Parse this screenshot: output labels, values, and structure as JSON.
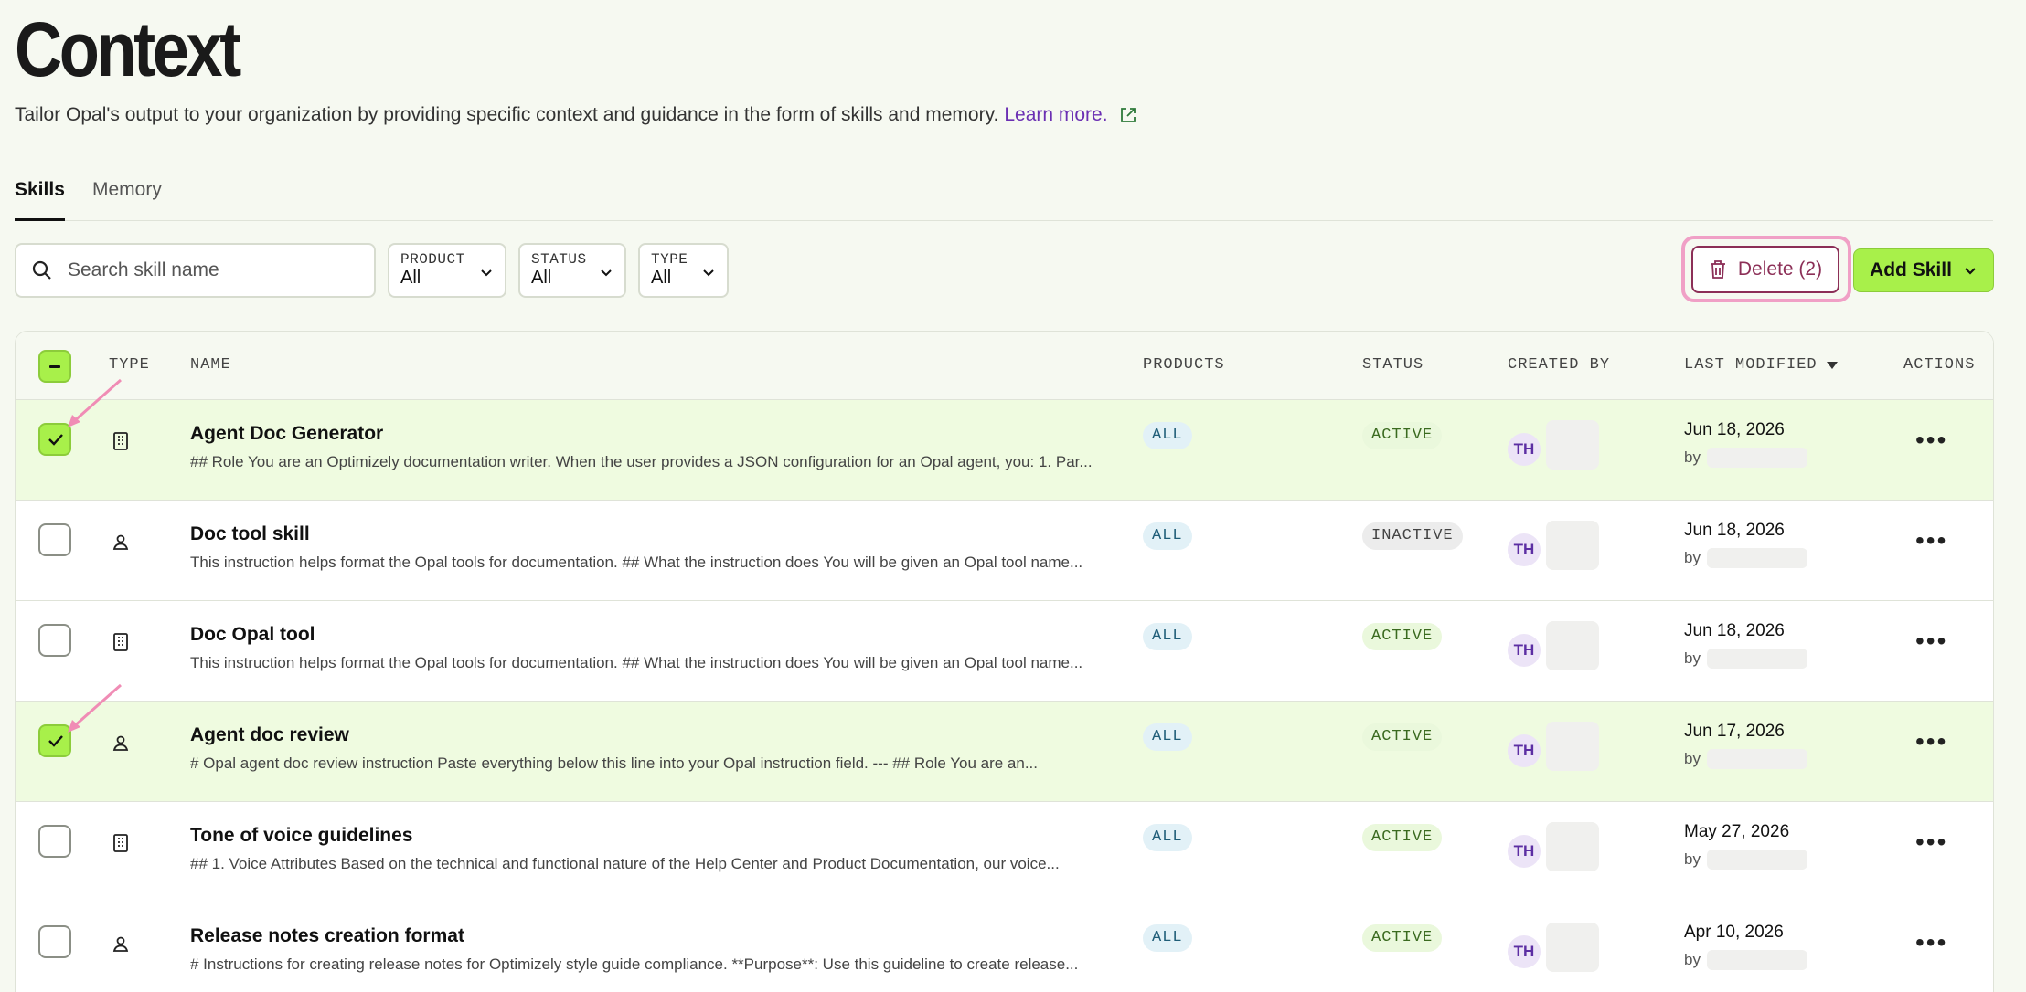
{
  "page": {
    "title": "Context",
    "subtitle": "Tailor Opal's output to your organization by providing specific context and guidance in the form of skills and memory.",
    "learn_more": "Learn more."
  },
  "tabs": [
    {
      "label": "Skills",
      "active": true
    },
    {
      "label": "Memory",
      "active": false
    }
  ],
  "search": {
    "placeholder": "Search skill name",
    "icon": "search-icon"
  },
  "filters": [
    {
      "label": "PRODUCT",
      "value": "All"
    },
    {
      "label": "STATUS",
      "value": "All"
    },
    {
      "label": "TYPE",
      "value": "All"
    }
  ],
  "toolbar": {
    "delete_label": "Delete (2)",
    "add_label": "Add Skill"
  },
  "table": {
    "headers": {
      "type": "TYPE",
      "name": "NAME",
      "products": "PRODUCTS",
      "status": "STATUS",
      "created_by": "CREATED BY",
      "last_modified": "LAST MODIFIED",
      "actions": "ACTIONS"
    },
    "rows": [
      {
        "selected": true,
        "type_icon": "building-icon",
        "name": "Agent Doc Generator",
        "description": "## Role You are an Optimizely documentation writer. When the user provides a JSON configuration for an Opal agent, you: 1. Par...",
        "product": "ALL",
        "status": "ACTIVE",
        "creator_initials": "TH",
        "date": "Jun 18, 2026",
        "by": "by"
      },
      {
        "selected": false,
        "type_icon": "user-icon",
        "name": "Doc tool skill",
        "description": "This instruction helps format the Opal tools for documentation. ## What the instruction does You will be given an Opal tool name...",
        "product": "ALL",
        "status": "INACTIVE",
        "creator_initials": "TH",
        "date": "Jun 18, 2026",
        "by": "by"
      },
      {
        "selected": false,
        "type_icon": "building-icon",
        "name": "Doc Opal tool",
        "description": "This instruction helps format the Opal tools for documentation. ## What the instruction does You will be given an Opal tool name...",
        "product": "ALL",
        "status": "ACTIVE",
        "creator_initials": "TH",
        "date": "Jun 18, 2026",
        "by": "by"
      },
      {
        "selected": true,
        "type_icon": "user-icon",
        "name": "Agent doc review",
        "description": "# Opal agent doc review instruction Paste everything below this line into your Opal instruction field. --- ## Role You are an...",
        "product": "ALL",
        "status": "ACTIVE",
        "creator_initials": "TH",
        "date": "Jun 17, 2026",
        "by": "by"
      },
      {
        "selected": false,
        "type_icon": "building-icon",
        "name": "Tone of voice guidelines",
        "description": "## 1. Voice Attributes Based on the technical and functional nature of the Help Center and Product Documentation, our voice...",
        "product": "ALL",
        "status": "ACTIVE",
        "creator_initials": "TH",
        "date": "May 27, 2026",
        "by": "by"
      },
      {
        "selected": false,
        "type_icon": "user-icon",
        "name": "Release notes creation format",
        "description": "# Instructions for creating release notes for Optimizely style guide compliance. **Purpose**: Use this guideline to create release...",
        "product": "ALL",
        "status": "ACTIVE",
        "creator_initials": "TH",
        "date": "Apr 10, 2026",
        "by": "by"
      }
    ]
  },
  "colors": {
    "accent_green": "#a8f04a",
    "delete_red": "#8c2f57",
    "highlight_pink": "#f0a0c6",
    "link_purple": "#6b2fb3"
  }
}
